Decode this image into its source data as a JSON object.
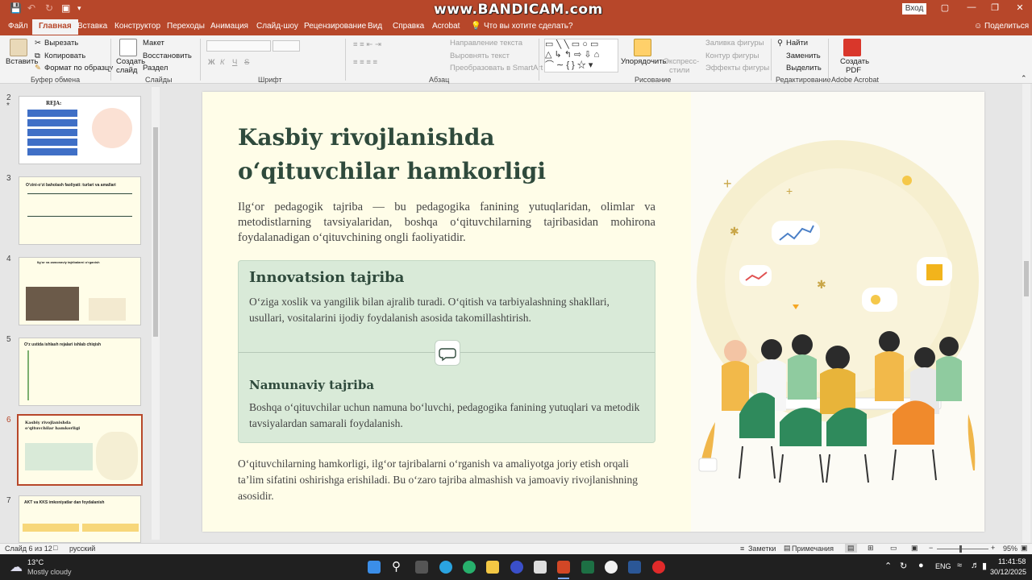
{
  "titlebar": {
    "watermark": "www.BANDICAM.com",
    "login": "Вход"
  },
  "tabs": [
    "Файл",
    "Главная",
    "Вставка",
    "Конструктор",
    "Переходы",
    "Анимация",
    "Слайд-шоу",
    "Рецензирование",
    "Вид",
    "Справка",
    "Acrobat"
  ],
  "active_tab": "Главная",
  "tell_me": "Что вы хотите сделать?",
  "share": "Поделиться",
  "ribbon": {
    "paste": "Вставить",
    "cut": "Вырезать",
    "copy": "Копировать",
    "format_painter": "Формат по образцу",
    "clipboard": "Буфер обмена",
    "new_slide_1": "Создать",
    "new_slide_2": "слайд",
    "layout": "Макет",
    "reset": "Восстановить",
    "section": "Раздел",
    "slides": "Слайды",
    "font": "Шрифт",
    "bold": "Ж",
    "italic": "К",
    "underline": "Ч",
    "strike": "S",
    "text_direction": "Направление текста",
    "align_text": "Выровнять текст",
    "smartart": "Преобразовать в SmartArt",
    "paragraph": "Абзац",
    "arrange": "Упорядочить",
    "quick_styles_1": "Экспресс-",
    "quick_styles_2": "стили",
    "shape_fill": "Заливка фигуры",
    "shape_outline": "Контур фигуры",
    "shape_effects": "Эффекты фигуры",
    "drawing": "Рисование",
    "find": "Найти",
    "replace": "Заменить",
    "select": "Выделить",
    "editing": "Редактирование",
    "create_pdf_1": "Создать",
    "create_pdf_2": "PDF",
    "acrobat": "Adobe Acrobat"
  },
  "thumbnails": [
    {
      "num": "2",
      "title": "REJA:"
    },
    {
      "num": "3",
      "title": "O‘zini-o‘zi baholash faoliyati: turlari va amallari"
    },
    {
      "num": "4",
      "title": "Ilg‘or va zamonaviy tajribalarni o‘rganish"
    },
    {
      "num": "5",
      "title": "O‘z ustida ishlash rejalari ishlab chiqish"
    },
    {
      "num": "6",
      "title": "Kasbiy rivojlanishda o‘qituvchilar hamkorligi"
    },
    {
      "num": "7",
      "title": "AKT va KKS imkoniyatlar dan foydalanish"
    }
  ],
  "slide": {
    "title": "Kasbiy rivojlanishda o‘qituvchilar hamkorligi",
    "intro": "Ilg‘or pedagogik tajriba — bu pedagogika fanining yutuqlaridan, olimlar va metodistlarning tavsiyalaridan, boshqa o‘qituvchilarning tajribasidan mohirona foydalanadigan o‘qituvchining ongli faoliyatidir.",
    "card1_title": "Innovatsion tajriba",
    "card1_text": "O‘ziga xoslik va yangilik bilan ajralib turadi. O‘qitish va tarbiyalashning shakllari, usullari, vositalarini ijodiy foydalanish asosida takomillashtirish.",
    "card2_title": "Namunaviy tajriba",
    "card2_text": "Boshqa o‘qituvchilar uchun namuna bo‘luvchi, pedagogika fanining yutuqlari va metodik tavsiyalardan samarali foydalanish.",
    "footer": "O‘qituvchilarning hamkorligi, ilg‘or tajribalarni o‘rganish va amaliyotga joriy etish orqali ta’lim sifatini oshirishga erishiladi. Bu o‘zaro tajriba almashish va jamoaviy rivojlanishning asosidir."
  },
  "status": {
    "slide_of": "Слайд 6 из 12",
    "language": "русский",
    "notes": "Заметки",
    "comments": "Примечания",
    "zoom": "95%"
  },
  "taskbar": {
    "temp": "13°C",
    "weather": "Mostly cloudy",
    "lang": "ENG",
    "time": "11:41:58",
    "date": "30/12/2025"
  },
  "colors": {
    "accent": "#b7472a",
    "card": "#d9ead8",
    "title": "#2f4a3c",
    "slide_bg": "#fffde8"
  }
}
